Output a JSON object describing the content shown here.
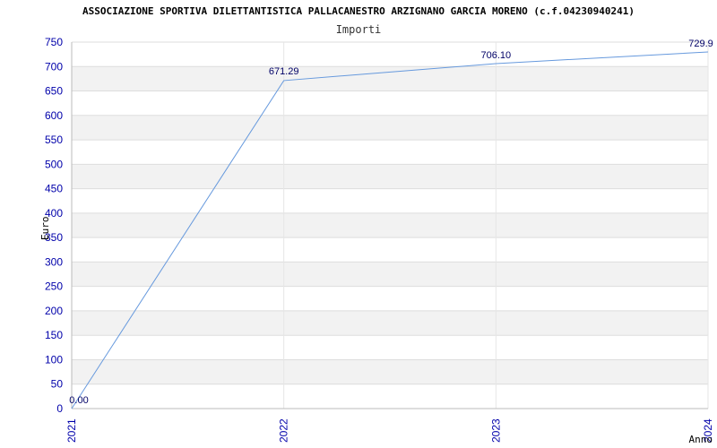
{
  "chart_data": {
    "type": "line",
    "title": "ASSOCIAZIONE SPORTIVA DILETTANTISTICA PALLACANESTRO ARZIGNANO GARCIA MORENO (c.f.04230940241)",
    "subtitle": "Importi",
    "xlabel": "Anno",
    "ylabel": "Euro",
    "ylim": [
      0,
      750
    ],
    "yticks": [
      0,
      50,
      100,
      150,
      200,
      250,
      300,
      350,
      400,
      450,
      500,
      550,
      600,
      650,
      700,
      750
    ],
    "x": [
      "2021",
      "2022",
      "2023",
      "2024"
    ],
    "series": [
      {
        "values": [
          0.0,
          671.29,
          706.1,
          729.9
        ],
        "labels": [
          "0.00",
          "671.29",
          "706.10",
          "729.9"
        ]
      }
    ],
    "grid": true,
    "legend": "none",
    "line_color": "#6699dd",
    "band_color": "#f2f2f2",
    "tick_color": "#0000aa"
  }
}
